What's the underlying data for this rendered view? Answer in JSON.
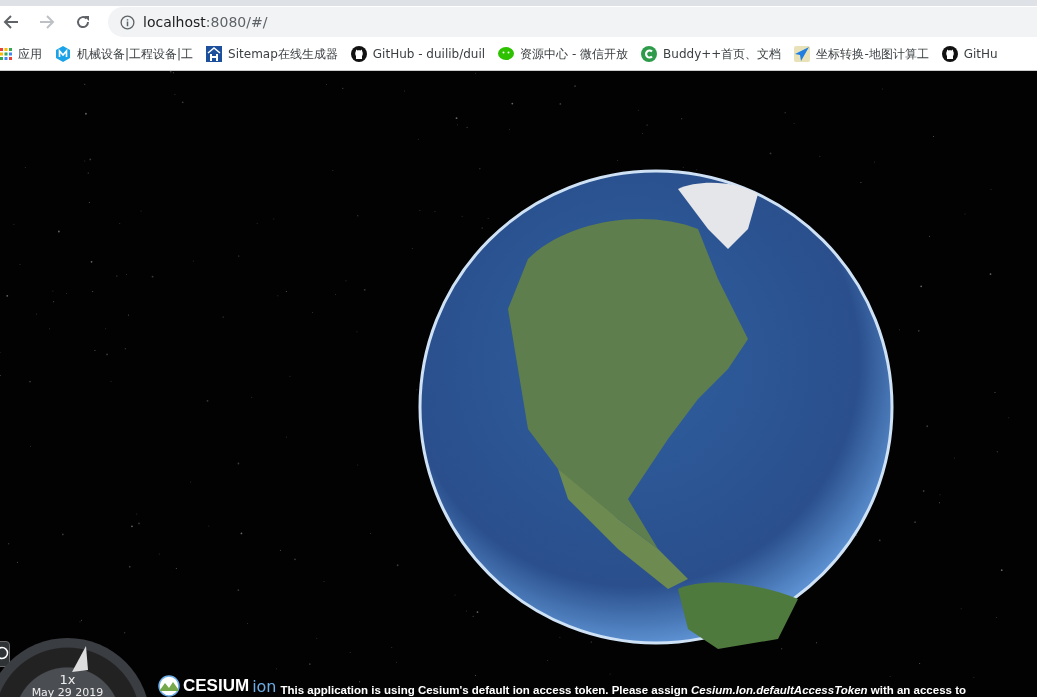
{
  "browser": {
    "address": {
      "host": "localhost",
      "rest": ":8080/#/"
    },
    "bookmarks": [
      {
        "kind": "apps",
        "label": "应用"
      },
      {
        "kind": "m",
        "label": "机械设备|工程设备|工"
      },
      {
        "kind": "h",
        "label": "Sitemap在线生成器"
      },
      {
        "kind": "github",
        "label": "GitHub - duilib/duil"
      },
      {
        "kind": "wechat",
        "label": "资源中心 - 微信开放"
      },
      {
        "kind": "c",
        "label": "Buddy++首页、文档"
      },
      {
        "kind": "plane",
        "label": "坐标转换-地图计算工"
      },
      {
        "kind": "github",
        "label": "GitHu"
      }
    ]
  },
  "viewer": {
    "animation": {
      "speed": "1x",
      "date": "May 29 2019"
    },
    "logo": {
      "name": "CESIUM",
      "suffix": "ion"
    },
    "credit": "This application is using Cesium's default ion access token. Please assign *Cesium.Ion.defaultAccessToken* with an access to"
  }
}
